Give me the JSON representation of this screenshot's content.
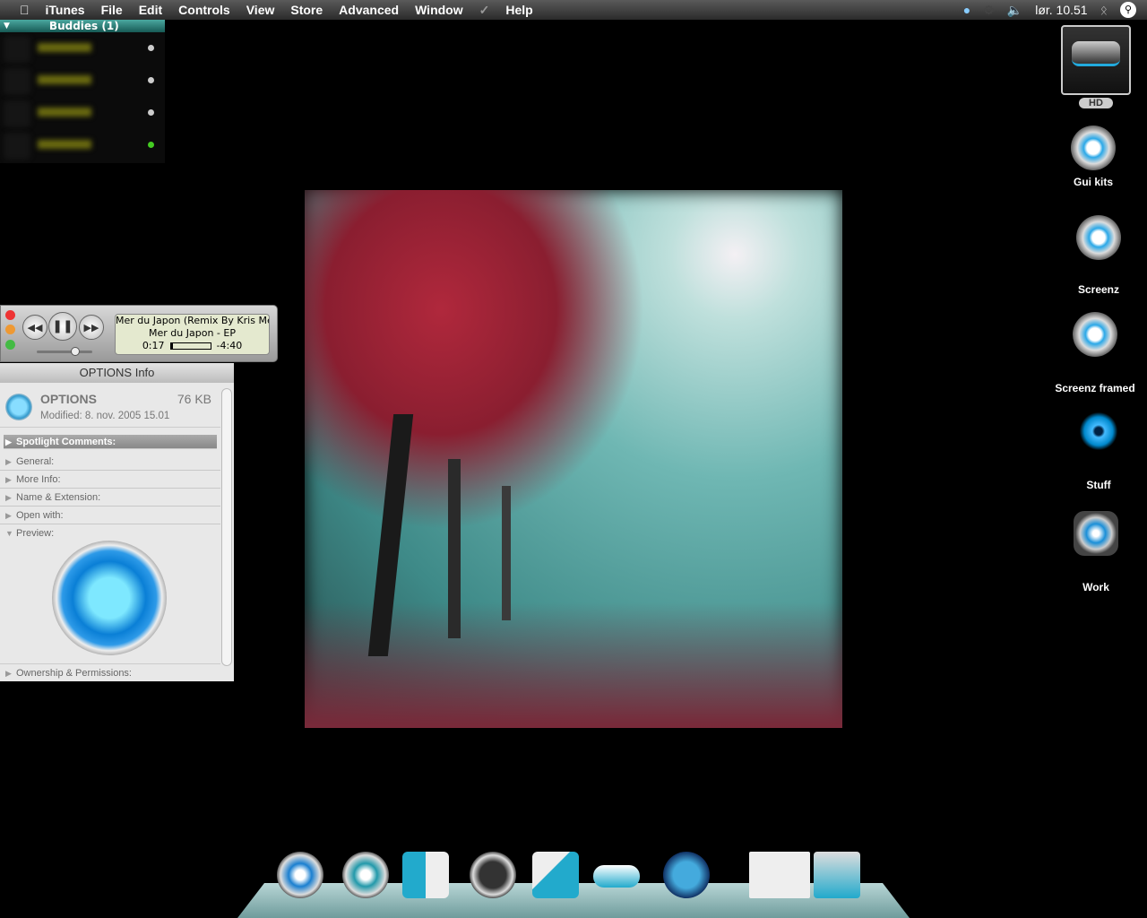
{
  "menubar": {
    "app": "iTunes",
    "items": [
      "File",
      "Edit",
      "Controls",
      "View",
      "Store",
      "Advanced",
      "Window",
      "Help"
    ],
    "clock": "lør. 10.51"
  },
  "buddies": {
    "title": "Buddies (1)",
    "statuses": [
      "#cccccc",
      "#cccccc",
      "#cccccc",
      "#44cc22"
    ]
  },
  "player": {
    "track": "Mer du Japon (Remix By Kris Me",
    "album": "Mer du Japon - EP",
    "elapsed": "0:17",
    "remaining": "-4:40",
    "progress": 0.06,
    "volume": 0.75
  },
  "info": {
    "title": "OPTIONS Info",
    "name": "OPTIONS",
    "size": "76 KB",
    "modified": "Modified: 8. nov. 2005 15.01",
    "sections": [
      "Spotlight Comments:",
      "General:",
      "More Info:",
      "Name & Extension:",
      "Open with:",
      "Preview:"
    ],
    "footer": "Ownership & Permissions:"
  },
  "sidebar": {
    "hd_label": "HD",
    "items": [
      "Gui kits",
      "Screenz",
      "Screenz framed",
      "Stuff",
      "Work"
    ]
  },
  "dock": {
    "icons": [
      "power-icon",
      "browser-icon",
      "finder-icon",
      "safari-icon",
      "mail-icon",
      "drive-icon",
      "mascot-icon",
      "documents-icon",
      "trash-icon"
    ]
  }
}
